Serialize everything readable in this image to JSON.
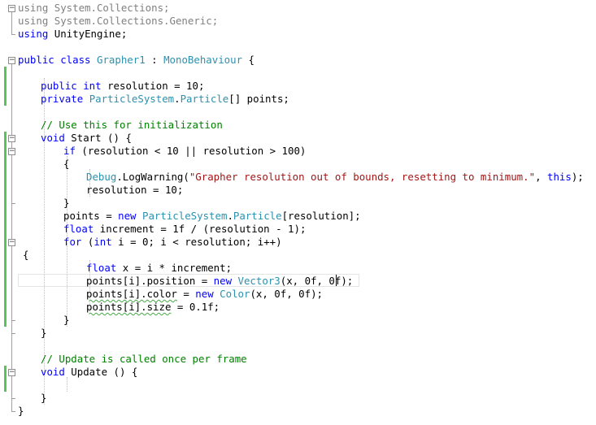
{
  "editor": {
    "lines": [
      {
        "indent": 22,
        "segments": [
          {
            "c": "gr",
            "t": "using System.Collections;"
          }
        ]
      },
      {
        "indent": 22,
        "segments": [
          {
            "c": "gr",
            "t": "using System.Collections.Generic;"
          }
        ]
      },
      {
        "indent": 22,
        "segments": [
          {
            "c": "kw",
            "t": "using"
          },
          {
            "c": "tx",
            "t": " UnityEngine;"
          }
        ]
      },
      {
        "indent": 22,
        "segments": []
      },
      {
        "indent": 22,
        "segments": [
          {
            "c": "kw",
            "t": "public class"
          },
          {
            "c": "tx",
            "t": " "
          },
          {
            "c": "ty",
            "t": "Grapher1"
          },
          {
            "c": "tx",
            "t": " : "
          },
          {
            "c": "ty",
            "t": "MonoBehaviour"
          },
          {
            "c": "tx",
            "t": " {"
          }
        ]
      },
      {
        "indent": 22,
        "segments": []
      },
      {
        "indent": 50,
        "segments": [
          {
            "c": "kw",
            "t": "public int"
          },
          {
            "c": "tx",
            "t": " resolution = 10;"
          }
        ]
      },
      {
        "indent": 50,
        "segments": [
          {
            "c": "kw",
            "t": "private"
          },
          {
            "c": "tx",
            "t": " "
          },
          {
            "c": "ty",
            "t": "ParticleSystem"
          },
          {
            "c": "tx",
            "t": "."
          },
          {
            "c": "ty",
            "t": "Particle"
          },
          {
            "c": "tx",
            "t": "[] points;"
          }
        ]
      },
      {
        "indent": 22,
        "segments": []
      },
      {
        "indent": 50,
        "segments": [
          {
            "c": "cm",
            "t": "// Use this for initialization"
          }
        ]
      },
      {
        "indent": 50,
        "segments": [
          {
            "c": "kw",
            "t": "void"
          },
          {
            "c": "tx",
            "t": " Start () {"
          }
        ]
      },
      {
        "indent": 78,
        "segments": [
          {
            "c": "kw",
            "t": "if"
          },
          {
            "c": "tx",
            "t": " (resolution < 10 || resolution > 100)"
          }
        ]
      },
      {
        "indent": 78,
        "segments": [
          {
            "c": "tx",
            "t": "{"
          }
        ]
      },
      {
        "indent": 106,
        "segments": [
          {
            "c": "ty",
            "t": "Debug"
          },
          {
            "c": "tx",
            "t": ".LogWarning("
          },
          {
            "c": "st",
            "t": "\"Grapher resolution out of bounds, resetting to minimum.\""
          },
          {
            "c": "tx",
            "t": ", "
          },
          {
            "c": "kw",
            "t": "this"
          },
          {
            "c": "tx",
            "t": ");"
          }
        ]
      },
      {
        "indent": 106,
        "segments": [
          {
            "c": "tx",
            "t": "resolution = 10;"
          }
        ]
      },
      {
        "indent": 78,
        "segments": [
          {
            "c": "tx",
            "t": "}"
          }
        ]
      },
      {
        "indent": 78,
        "segments": [
          {
            "c": "tx",
            "t": "points = "
          },
          {
            "c": "kw",
            "t": "new"
          },
          {
            "c": "tx",
            "t": " "
          },
          {
            "c": "ty",
            "t": "ParticleSystem"
          },
          {
            "c": "tx",
            "t": "."
          },
          {
            "c": "ty",
            "t": "Particle"
          },
          {
            "c": "tx",
            "t": "[resolution];"
          }
        ]
      },
      {
        "indent": 78,
        "segments": [
          {
            "c": "kw",
            "t": "float"
          },
          {
            "c": "tx",
            "t": " increment = 1f / (resolution - 1);"
          }
        ]
      },
      {
        "indent": 78,
        "segments": [
          {
            "c": "kw",
            "t": "for"
          },
          {
            "c": "tx",
            "t": " ("
          },
          {
            "c": "kw",
            "t": "int"
          },
          {
            "c": "tx",
            "t": " i = 0; i < resolution; i++)"
          }
        ]
      },
      {
        "indent": 28,
        "segments": [
          {
            "c": "tx",
            "t": "{"
          }
        ]
      },
      {
        "indent": 106,
        "segments": [
          {
            "c": "kw",
            "t": "float"
          },
          {
            "c": "tx",
            "t": " x = i * increment;"
          }
        ]
      },
      {
        "indent": 106,
        "segments": [
          {
            "c": "tx",
            "t": "points[i].position = "
          },
          {
            "c": "kw",
            "t": "new"
          },
          {
            "c": "tx",
            "t": " "
          },
          {
            "c": "ty",
            "t": "Vector3"
          },
          {
            "c": "tx",
            "t": "(x, 0f, 0f);"
          }
        ]
      },
      {
        "indent": 106,
        "segments": [
          {
            "c": "tx sq",
            "t": "points[i].color"
          },
          {
            "c": "tx",
            "t": " = "
          },
          {
            "c": "kw",
            "t": "new"
          },
          {
            "c": "tx",
            "t": " "
          },
          {
            "c": "ty",
            "t": "Color"
          },
          {
            "c": "tx",
            "t": "(x, 0f, 0f);"
          }
        ]
      },
      {
        "indent": 106,
        "segments": [
          {
            "c": "tx sq",
            "t": "points[i].size"
          },
          {
            "c": "tx",
            "t": " = 0.1f;"
          }
        ]
      },
      {
        "indent": 78,
        "segments": [
          {
            "c": "tx",
            "t": "}"
          }
        ]
      },
      {
        "indent": 50,
        "segments": [
          {
            "c": "tx",
            "t": "}"
          }
        ]
      },
      {
        "indent": 22,
        "segments": []
      },
      {
        "indent": 50,
        "segments": [
          {
            "c": "cm",
            "t": "// Update is called once per frame"
          }
        ]
      },
      {
        "indent": 50,
        "segments": [
          {
            "c": "kw",
            "t": "void"
          },
          {
            "c": "tx",
            "t": " Update () {"
          }
        ]
      },
      {
        "indent": 22,
        "segments": []
      },
      {
        "indent": 50,
        "segments": [
          {
            "c": "tx",
            "t": "}"
          }
        ]
      },
      {
        "indent": 22,
        "segments": [
          {
            "c": "tx",
            "t": "}"
          }
        ]
      }
    ],
    "fold_markers": [
      {
        "line": 0,
        "symbol": "−"
      },
      {
        "line": 4,
        "symbol": "−"
      },
      {
        "line": 10,
        "symbol": "−"
      },
      {
        "line": 11,
        "symbol": "−"
      },
      {
        "line": 18,
        "symbol": "−"
      },
      {
        "line": 28,
        "symbol": "−"
      }
    ],
    "change_bars": [
      {
        "from": 5,
        "to": 7
      },
      {
        "from": 10,
        "to": 24
      },
      {
        "from": 28,
        "to": 29
      }
    ],
    "colors": {
      "keyword": "#0000ff",
      "type": "#2b91af",
      "comment": "#008000",
      "string": "#a31515",
      "change_bar": "#57c657"
    }
  }
}
